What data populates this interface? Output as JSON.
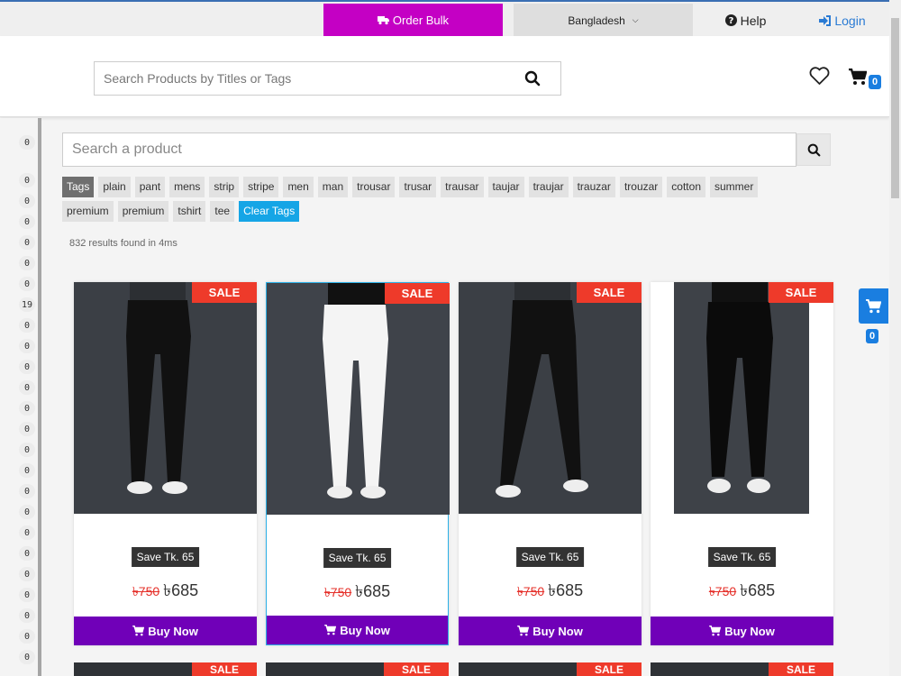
{
  "topbar": {
    "order_bulk": "Order Bulk",
    "country": "Bangladesh",
    "help": "Help",
    "login": "Login"
  },
  "header": {
    "search_placeholder": "Search Products by Titles or Tags",
    "cart_count": "0"
  },
  "sidebar": {
    "top_count": "0",
    "counts": [
      "0",
      "0",
      "0",
      "0",
      "0",
      "0",
      "19",
      "0",
      "0",
      "0",
      "0",
      "0",
      "0",
      "0",
      "0",
      "0",
      "0",
      "0",
      "0",
      "0",
      "0",
      "0",
      "0",
      "0",
      "0"
    ]
  },
  "main": {
    "search_placeholder": "Search a product",
    "tags_label": "Tags",
    "tags": [
      "plain",
      "pant",
      "mens",
      "strip",
      "stripe",
      "men",
      "man",
      "trousar",
      "trusar",
      "trausar",
      "taujar",
      "traujar",
      "trauzar",
      "trouzar",
      "cotton",
      "summer",
      "premium",
      "premium",
      "tshirt",
      "tee"
    ],
    "clear_tags": "Clear Tags",
    "results_text": "832 results found in 4ms"
  },
  "products": [
    {
      "sale": "SALE",
      "save": "Save Tk. 65",
      "old_price": "৳750",
      "price": "৳685",
      "buy": "Buy Now",
      "color": "black"
    },
    {
      "sale": "SALE",
      "save": "Save Tk. 65",
      "old_price": "৳750",
      "price": "৳685",
      "buy": "Buy Now",
      "color": "white"
    },
    {
      "sale": "SALE",
      "save": "Save Tk. 65",
      "old_price": "৳750",
      "price": "৳685",
      "buy": "Buy Now",
      "color": "black"
    },
    {
      "sale": "SALE",
      "save": "Save Tk. 65",
      "old_price": "৳750",
      "price": "৳685",
      "buy": "Buy Now",
      "color": "black"
    }
  ],
  "row2": {
    "sale": "SALE"
  },
  "floating_cart": {
    "count": "0"
  },
  "colors": {
    "bulk": "#c400c4",
    "buy": "#7000b8",
    "sale": "#ee3a2a",
    "accent": "#1a7ee0",
    "clear_tags": "#15a5e6"
  }
}
